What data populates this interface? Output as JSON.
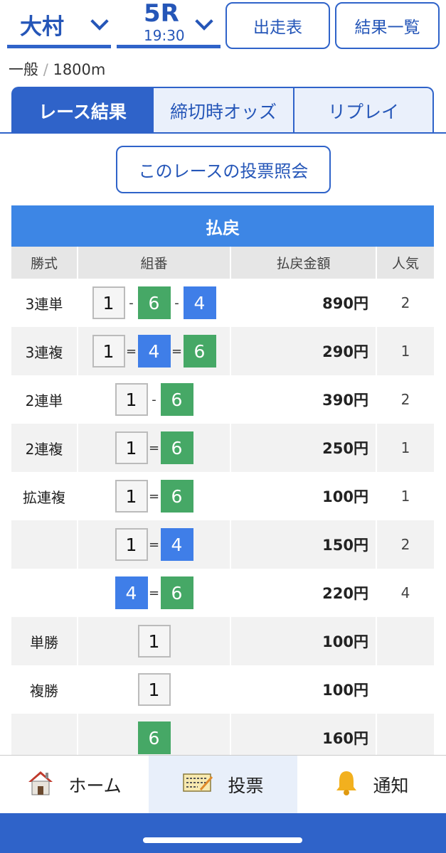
{
  "header": {
    "venue": "大村",
    "race_no": "5R",
    "race_time": "19:30",
    "entries_label": "出走表",
    "results_label": "結果一覧"
  },
  "race_info": {
    "grade": "一般",
    "separator": "/",
    "distance": "1800m"
  },
  "tabs": [
    {
      "label": "レース結果",
      "active": true
    },
    {
      "label": "締切時オッズ",
      "active": false
    },
    {
      "label": "リプレイ",
      "active": false
    }
  ],
  "inquiry_button": "このレースの投票照会",
  "payout": {
    "title": "払戻",
    "headers": [
      "勝式",
      "組番",
      "払戻金額",
      "人気"
    ],
    "rows": [
      {
        "type": "3連単",
        "combo": [
          "1",
          "6",
          "4"
        ],
        "ops": [
          "-",
          "-"
        ],
        "amount": "890円",
        "popularity": "2"
      },
      {
        "type": "3連複",
        "combo": [
          "1",
          "4",
          "6"
        ],
        "ops": [
          "=",
          "="
        ],
        "amount": "290円",
        "popularity": "1"
      },
      {
        "type": "2連単",
        "combo": [
          "1",
          "6"
        ],
        "ops": [
          "-"
        ],
        "amount": "390円",
        "popularity": "2"
      },
      {
        "type": "2連複",
        "combo": [
          "1",
          "6"
        ],
        "ops": [
          "="
        ],
        "amount": "250円",
        "popularity": "1"
      },
      {
        "type": "拡連複",
        "combo": [
          "1",
          "6"
        ],
        "ops": [
          "="
        ],
        "amount": "100円",
        "popularity": "1"
      },
      {
        "type": "",
        "combo": [
          "1",
          "4"
        ],
        "ops": [
          "="
        ],
        "amount": "150円",
        "popularity": "2"
      },
      {
        "type": "",
        "combo": [
          "4",
          "6"
        ],
        "ops": [
          "="
        ],
        "amount": "220円",
        "popularity": "4"
      },
      {
        "type": "単勝",
        "combo": [
          "1"
        ],
        "ops": [],
        "amount": "100円",
        "popularity": ""
      },
      {
        "type": "複勝",
        "combo": [
          "1"
        ],
        "ops": [],
        "amount": "100円",
        "popularity": ""
      },
      {
        "type": "",
        "combo": [
          "6"
        ],
        "ops": [],
        "amount": "160円",
        "popularity": ""
      }
    ]
  },
  "boat_colors": {
    "1": "#f5f5f5",
    "4": "#3f7ee8",
    "6": "#46a866"
  },
  "bottom_nav": [
    {
      "label": "ホーム",
      "icon": "house-icon"
    },
    {
      "label": "投票",
      "icon": "ticket-icon"
    },
    {
      "label": "通知",
      "icon": "bell-icon"
    }
  ],
  "colors": {
    "brand": "#2f63c9",
    "payout_header": "#3d86e5"
  }
}
